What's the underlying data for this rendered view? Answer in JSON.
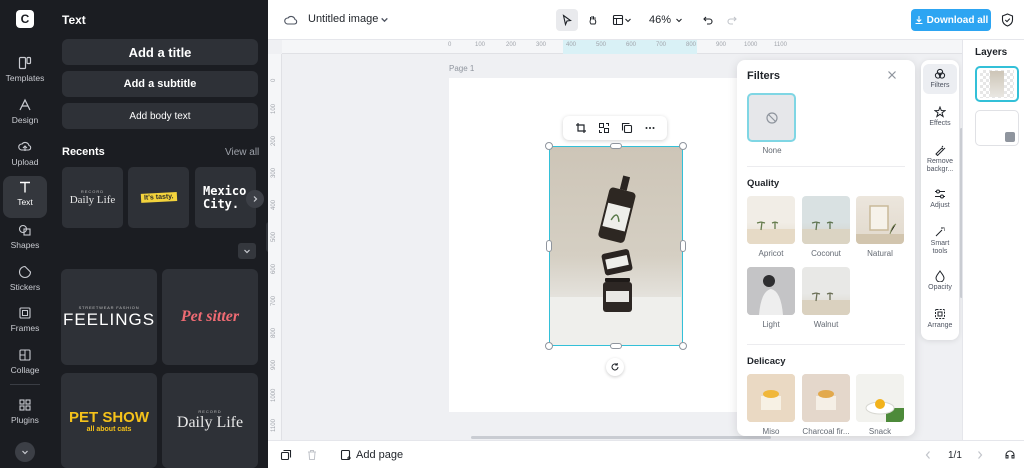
{
  "rail": {
    "items": [
      {
        "label": "Templates",
        "icon": "templates-icon"
      },
      {
        "label": "Design",
        "icon": "design-icon"
      },
      {
        "label": "Upload",
        "icon": "upload-icon"
      },
      {
        "label": "Text",
        "icon": "text-icon",
        "active": true
      },
      {
        "label": "Shapes",
        "icon": "shapes-icon"
      },
      {
        "label": "Stickers",
        "icon": "stickers-icon"
      },
      {
        "label": "Frames",
        "icon": "frames-icon"
      },
      {
        "label": "Collage",
        "icon": "collage-icon"
      },
      {
        "label": "Plugins",
        "icon": "plugins-icon"
      }
    ]
  },
  "panel": {
    "title": "Text",
    "add_title": "Add a title",
    "add_subtitle": "Add a subtitle",
    "add_body": "Add body text",
    "recents_label": "Recents",
    "view_all": "View all",
    "recents": [
      {
        "small": "RECORD",
        "main": "Daily Life"
      },
      {
        "main": "It's tasty."
      },
      {
        "main": "Mexico City."
      }
    ],
    "templates": [
      {
        "small": "STREETWEAR FASHION",
        "main": "FEELINGS"
      },
      {
        "main": "Pet sitter"
      },
      {
        "main": "PET SHOW",
        "sub": "all about cats"
      },
      {
        "small": "RECORD",
        "main": "Daily Life"
      }
    ]
  },
  "topbar": {
    "doc_name": "Untitled image",
    "zoom": "46%",
    "download_label": "Download all",
    "colors": {
      "accent": "#2da5f2"
    }
  },
  "canvas": {
    "page_label": "Page 1",
    "ruler_top": [
      "0",
      "100",
      "200",
      "300",
      "400",
      "500",
      "600",
      "700",
      "800",
      "900",
      "1000",
      "1100"
    ],
    "ruler_left": [
      "0",
      "100",
      "200",
      "300",
      "400",
      "500",
      "600",
      "700",
      "800",
      "900",
      "1000",
      "1100"
    ],
    "selection_color": "#33c0d8"
  },
  "filters": {
    "title": "Filters",
    "none_label": "None",
    "sections": [
      {
        "title": "Quality",
        "items": [
          "Apricot",
          "Coconut",
          "Natural",
          "Light",
          "Walnut"
        ]
      },
      {
        "title": "Delicacy",
        "items": [
          "Miso",
          "Charcoal fir...",
          "Snack"
        ]
      }
    ]
  },
  "tools": [
    {
      "label": "Filters",
      "icon": "filters-icon",
      "active": true
    },
    {
      "label": "Effects",
      "icon": "effects-icon"
    },
    {
      "label": "Remove backgr...",
      "icon": "remove-background-icon"
    },
    {
      "label": "Adjust",
      "icon": "adjust-icon"
    },
    {
      "label": "Smart tools",
      "icon": "smart-tools-icon"
    },
    {
      "label": "Opacity",
      "icon": "opacity-icon"
    },
    {
      "label": "Arrange",
      "icon": "arrange-icon"
    }
  ],
  "layers": {
    "title": "Layers"
  },
  "bottombar": {
    "add_page": "Add page",
    "page_counter": "1/1"
  }
}
